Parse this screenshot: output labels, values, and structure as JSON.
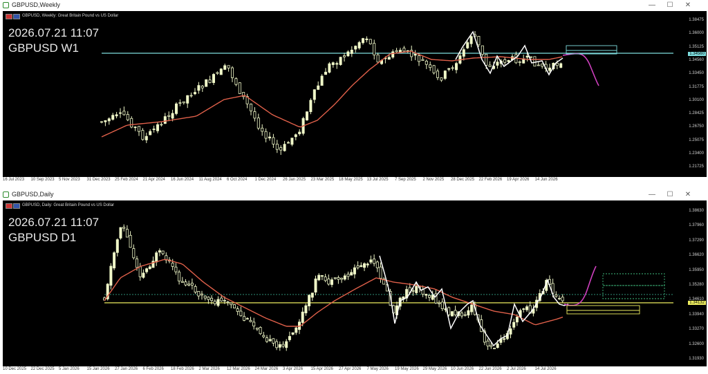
{
  "weekly": {
    "window_title": "GBPUSD,Weekly",
    "header": "GBPUSD, Weekly:  Great Britain Pound vs US Dollar",
    "datetime": "2026.07.21 11:07",
    "symbol_tf": "GBPUSD W1",
    "price_ticks": [
      "1.38475",
      "1.36000",
      "1.35125",
      "1.34560",
      "1.33450",
      "1.31775",
      "1.30100",
      "1.28425",
      "1.26750",
      "1.25075",
      "1.23400",
      "1.21725"
    ],
    "current_price": "1.34560",
    "date_ticks": [
      "16 Jul 2023",
      "10 Sep 2023",
      "5 Nov 2023",
      "31 Dec 2023",
      "25 Feb 2024",
      "21 Apr 2024",
      "16 Jun 2024",
      "11 Aug 2024",
      "6 Oct 2024",
      "1 Dec 2024",
      "26 Jan 2025",
      "23 Mar 2025",
      "18 May 2025",
      "13 Jul 2025",
      "7 Sep 2025",
      "2 Nov 2025",
      "28 Dec 2025",
      "22 Feb 2026",
      "19 Apr 2026",
      "14 Jun 2026"
    ],
    "colors": {
      "candles": "#f0f8c8",
      "ma": "#e0604a",
      "projection": "#d040c0",
      "level": "#7fdfe0",
      "zigzag": "#ffffff"
    }
  },
  "daily": {
    "window_title": "GBPUSD,Daily",
    "header": "GBPUSD, Daily:  Great Britain Pound vs US Dollar",
    "datetime": "2026.07.21 11:07",
    "symbol_tf": "GBPUSD D1",
    "price_ticks": [
      "1.38630",
      "1.37960",
      "1.37290",
      "1.36620",
      "1.35950",
      "1.35280",
      "1.34610",
      "1.33940",
      "1.33270",
      "1.32600",
      "1.31930"
    ],
    "current_price": "1.34132",
    "date_ticks": [
      "10 Dec 2025",
      "22 Dec 2025",
      "5 Jan 2026",
      "15 Jan 2026",
      "27 Jan 2026",
      "6 Feb 2026",
      "18 Feb 2026",
      "2 Mar 2026",
      "12 Mar 2026",
      "24 Mar 2026",
      "3 Apr 2026",
      "15 Apr 2026",
      "27 Apr 2026",
      "7 May 2026",
      "19 May 2026",
      "29 May 2026",
      "10 Jun 2026",
      "22 Jun 2026",
      "2 Jul 2026",
      "14 Jul 2026"
    ],
    "colors": {
      "candles": "#f0f8c8",
      "ma": "#e0604a",
      "projection": "#d040c0",
      "level": "#f0f060",
      "zigzag": "#ffffff",
      "box": "#3fbf7f"
    }
  },
  "window_buttons": {
    "minimize": "—",
    "maximize": "☐",
    "close": "✕"
  }
}
